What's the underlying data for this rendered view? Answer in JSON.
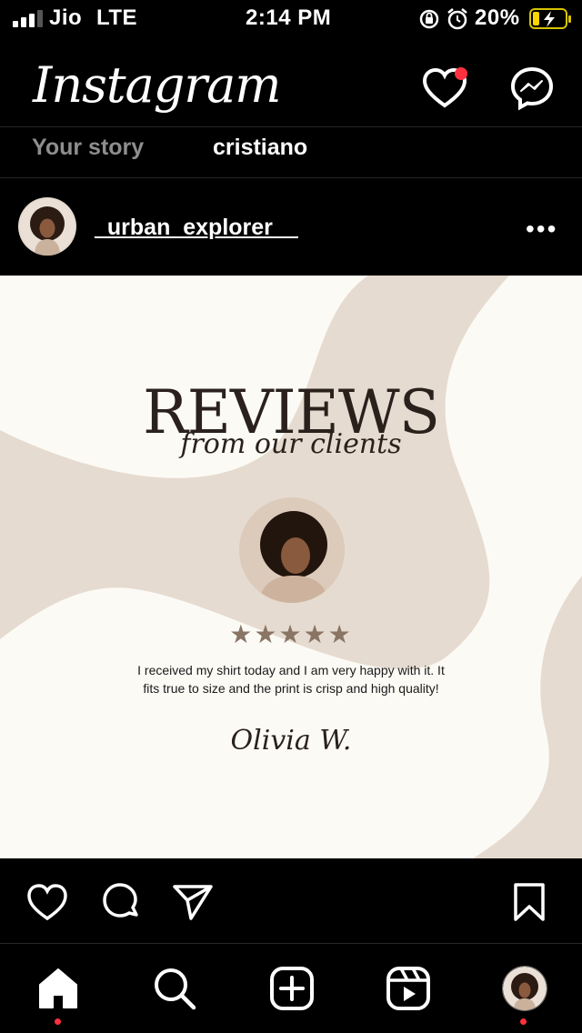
{
  "status_bar": {
    "carrier": "Jio",
    "network": "LTE",
    "time": "2:14 PM",
    "battery": "20%"
  },
  "header": {
    "logo": "Instagram",
    "notification_dot_color": "#ff3040"
  },
  "stories": [
    {
      "label": "Your story"
    },
    {
      "label": "cristiano"
    }
  ],
  "post": {
    "author": "_urban_explorer__",
    "more": "•••",
    "title": "REVIEWS",
    "subtitle": "from our clients",
    "rating_stars": "★★★★★",
    "rating": 5,
    "review": "I received my shirt today and I am very happy with it. It fits true to size and the print is crisp and high quality!",
    "signature": "Olivia W.",
    "colors": {
      "bg": "#fcfaf5",
      "swirl": "#e6dbd0",
      "star": "#8a7565",
      "text": "#2a211c"
    }
  },
  "actions": {
    "like": "heart-icon",
    "comment": "comment-icon",
    "share": "share-icon",
    "save": "bookmark-icon"
  },
  "bottom_nav": [
    "home-icon",
    "search-icon",
    "create-icon",
    "reels-icon",
    "profile-avatar"
  ]
}
